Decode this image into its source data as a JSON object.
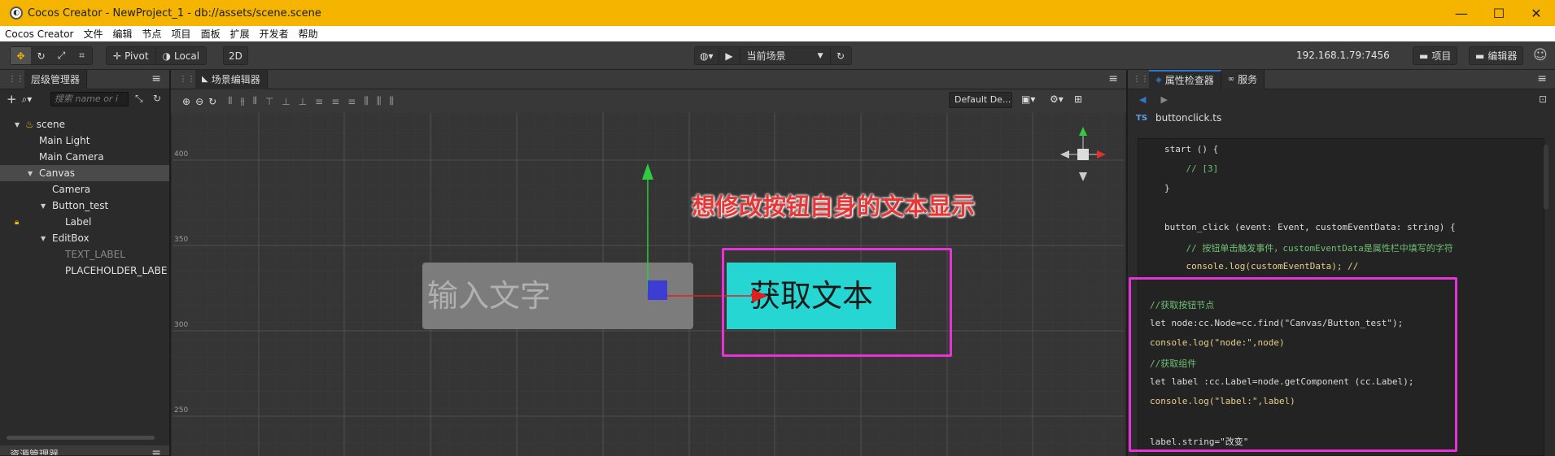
{
  "window": {
    "title": "Cocos Creator - NewProject_1 - db://assets/scene.scene"
  },
  "menu": [
    "Cocos Creator",
    "文件",
    "编辑",
    "节点",
    "项目",
    "面板",
    "扩展",
    "开发者",
    "帮助"
  ],
  "toolbar": {
    "pivot": "Pivot",
    "local": "Local",
    "mode2d": "2D",
    "scene_select": "当前场景",
    "ip": "192.168.1.79:7456",
    "project_btn": "项目",
    "editor_btn": "编辑器"
  },
  "hierarchy": {
    "title": "层级管理器",
    "search_placeholder": "搜索 name or i",
    "items": [
      {
        "label": "scene",
        "depth": 0
      },
      {
        "label": "Main Light",
        "depth": 1
      },
      {
        "label": "Main Camera",
        "depth": 1
      },
      {
        "label": "Canvas",
        "depth": 1
      },
      {
        "label": "Camera",
        "depth": 2
      },
      {
        "label": "Button_test",
        "depth": 2
      },
      {
        "label": "Label",
        "depth": 3
      },
      {
        "label": "EditBox",
        "depth": 2
      },
      {
        "label": "TEXT_LABEL",
        "depth": 3
      },
      {
        "label": "PLACEHOLDER_LABE",
        "depth": 3
      }
    ],
    "assets_title": "资源管理器"
  },
  "scene_editor": {
    "title": "场景编辑器",
    "resolution": "Default De...",
    "ruler": [
      "400",
      "350",
      "300",
      "250"
    ],
    "annotation": "想修改按钮自身的文本显示",
    "editbox_placeholder": "输入文字",
    "button_label": "获取文本"
  },
  "inspector": {
    "tab_inspector": "属性检查器",
    "tab_service": "服务",
    "file_badge": "TS",
    "file_name": "buttonclick.ts",
    "code_top": [
      "start () {",
      "    // [3]",
      "}",
      "",
      "button_click (event: Event, customEventData: string) {",
      "    // 按钮单击触发事件，customEventData是属性栏中填写的字符",
      "    console.log(customEventData); //"
    ],
    "code_box": [
      "//获取按钮节点",
      "let node:cc.Node=cc.find(\"Canvas/Button_test\");",
      "console.log(\"node:\",node)",
      "//获取组件",
      "let label :cc.Label=node.getComponent (cc.Label);",
      "console.log(\"label:\",label)",
      "",
      "label.string=\"改变\""
    ]
  },
  "colors": {
    "title_bar": "#f4b400",
    "highlight_box": "#e633d6",
    "button_cyan": "#25d6d3",
    "annotation_red": "#e83535",
    "tab_accent": "#2e77d0"
  }
}
